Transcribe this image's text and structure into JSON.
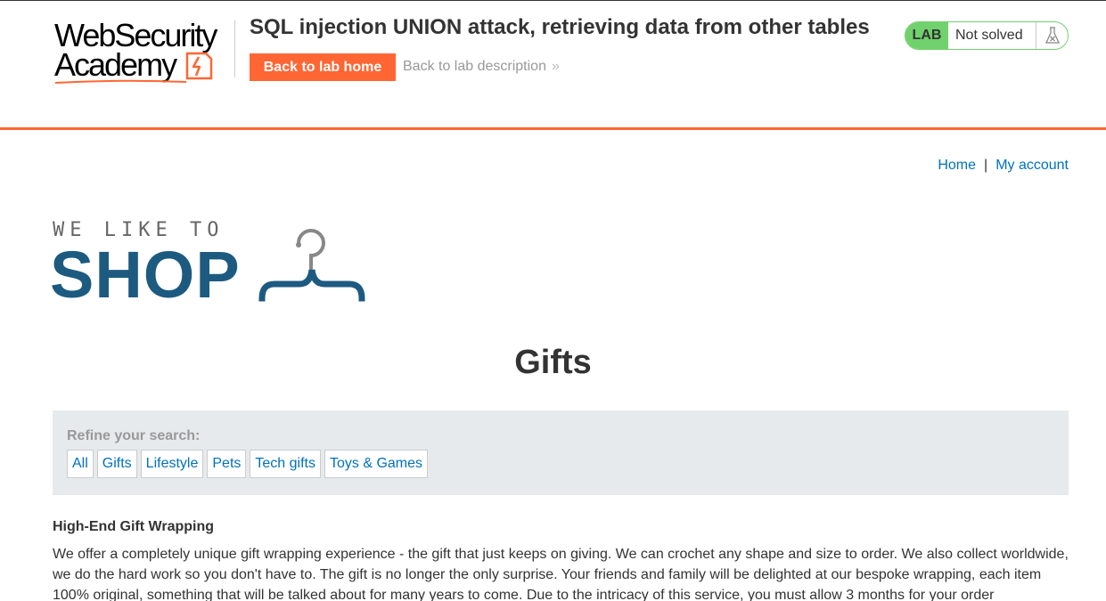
{
  "academy": {
    "logo_line1": "WebSecurity",
    "logo_line2": "Academy",
    "lab_title": "SQL injection UNION attack, retrieving data from other tables",
    "back_home_label": "Back to lab home",
    "back_desc_label": "Back to lab description",
    "back_desc_chevron": "»",
    "status_badge": "LAB",
    "status_text": "Not solved",
    "accent_color": "#ff6633",
    "status_color": "#70d16d",
    "flask_icon": "flask-icon"
  },
  "nav": {
    "home": "Home",
    "separator": "|",
    "my_account": "My account"
  },
  "shop_logo": {
    "tagline": "WE LIKE TO",
    "wordmark": "SHOP",
    "icon": "hanger-icon",
    "color": "#1d5a80"
  },
  "page": {
    "heading": "Gifts"
  },
  "filters": {
    "label": "Refine your search:",
    "items": [
      "All",
      "Gifts",
      "Lifestyle",
      "Pets",
      "Tech gifts",
      "Toys & Games"
    ]
  },
  "products": [
    {
      "title": "High-End Gift Wrapping",
      "description": "We offer a completely unique gift wrapping experience - the gift that just keeps on giving. We can crochet any shape and size to order. We also collect worldwide, we do the hard work so you don't have to. The gift is no longer the only surprise. Your friends and family will be delighted at our bespoke wrapping, each item 100% original, something that will be talked about for many years to come. Due to the intricacy of this service, you must allow 3 months for your order"
    }
  ]
}
